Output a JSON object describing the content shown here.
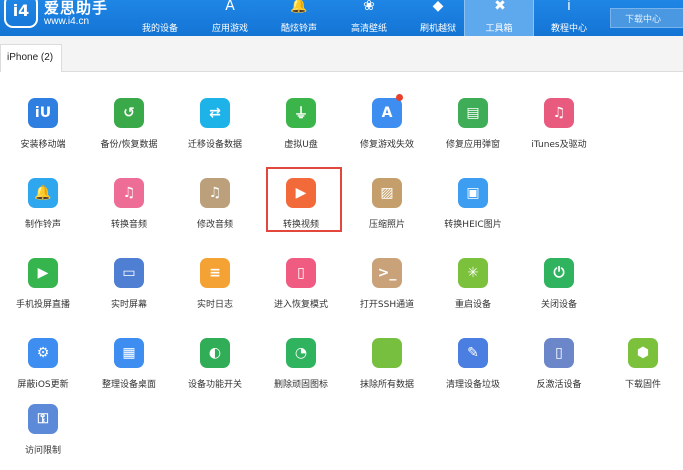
{
  "app": {
    "name": "爱思助手",
    "url": "www.i4.cn",
    "logo_text": "i4"
  },
  "nav": [
    {
      "label": "我的设备",
      "icon": "apple-icon",
      "glyph": ""
    },
    {
      "label": "应用游戏",
      "icon": "app-store-icon",
      "glyph": "A"
    },
    {
      "label": "酷炫铃声",
      "icon": "bell-icon",
      "glyph": "🔔"
    },
    {
      "label": "高清壁纸",
      "icon": "flower-icon",
      "glyph": "❀"
    },
    {
      "label": "刷机越狱",
      "icon": "dropbox-icon",
      "glyph": "◆"
    },
    {
      "label": "工具箱",
      "icon": "toolbox-icon",
      "glyph": "✖"
    },
    {
      "label": "教程中心",
      "icon": "info-icon",
      "glyph": "i"
    }
  ],
  "download_center": "下载中心",
  "device_tab": "iPhone (2)",
  "tools": [
    {
      "label": "安装移动端",
      "icon": "i4-mobile-icon",
      "color": "#2f7fe0",
      "glyph": "iU",
      "has_dot": false
    },
    {
      "label": "备份/恢复数据",
      "icon": "backup-clock-icon",
      "color": "#3aa94a",
      "glyph": "↺",
      "has_dot": false
    },
    {
      "label": "迁移设备数据",
      "icon": "transfer-devices-icon",
      "color": "#1db3e8",
      "glyph": "⇄",
      "has_dot": false
    },
    {
      "label": "虚拟U盘",
      "icon": "usb-drive-icon",
      "color": "#3bb54a",
      "glyph": "⏚",
      "has_dot": false
    },
    {
      "label": "修复游戏失效",
      "icon": "app-store-repair-icon",
      "color": "#3d8ef0",
      "glyph": "A",
      "has_dot": true
    },
    {
      "label": "修复应用弹窗",
      "icon": "apple-id-card-icon",
      "color": "#3fad57",
      "glyph": "▤",
      "has_dot": false
    },
    {
      "label": "iTunes及驱动",
      "icon": "itunes-icon",
      "color": "#e95b7e",
      "glyph": "♫",
      "has_dot": false
    },
    {
      "label": "制作铃声",
      "icon": "bell-plus-icon",
      "color": "#2fa7ef",
      "glyph": "🔔",
      "has_dot": false
    },
    {
      "label": "转换音频",
      "icon": "audio-convert-icon",
      "color": "#ee6d96",
      "glyph": "♫",
      "has_dot": false
    },
    {
      "label": "修改音频",
      "icon": "audio-edit-icon",
      "color": "#bba07b",
      "glyph": "♫",
      "has_dot": false
    },
    {
      "label": "转换视频",
      "icon": "video-convert-icon",
      "color": "#f36a3a",
      "glyph": "▶",
      "has_dot": false
    },
    {
      "label": "压缩照片",
      "icon": "photo-compress-icon",
      "color": "#c59f6b",
      "glyph": "▨",
      "has_dot": false
    },
    {
      "label": "转换HEIC图片",
      "icon": "heic-convert-icon",
      "color": "#3d9df0",
      "glyph": "▣",
      "has_dot": false
    },
    {
      "label": "手机投屏直播",
      "icon": "screen-cast-icon",
      "color": "#36b44d",
      "glyph": "▶",
      "has_dot": false
    },
    {
      "label": "实时屏幕",
      "icon": "monitor-icon",
      "color": "#4f7fd3",
      "glyph": "▭",
      "has_dot": false
    },
    {
      "label": "实时日志",
      "icon": "log-document-icon",
      "color": "#f4a233",
      "glyph": "≡",
      "has_dot": false
    },
    {
      "label": "进入恢复模式",
      "icon": "recovery-mode-icon",
      "color": "#ef5b81",
      "glyph": "▯",
      "has_dot": false
    },
    {
      "label": "打开SSH通道",
      "icon": "ssh-terminal-icon",
      "color": "#c9a27a",
      "glyph": ">_",
      "has_dot": false
    },
    {
      "label": "重启设备",
      "icon": "restart-icon",
      "color": "#7cc13c",
      "glyph": "✳",
      "has_dot": false
    },
    {
      "label": "关闭设备",
      "icon": "power-icon",
      "color": "#2fb35e",
      "glyph": "⏻",
      "has_dot": false
    },
    {
      "label": "屏蔽iOS更新",
      "icon": "block-update-gear-icon",
      "color": "#3d8ef0",
      "glyph": "⚙",
      "has_dot": false
    },
    {
      "label": "整理设备桌面",
      "icon": "desktop-grid-icon",
      "color": "#3d8ef0",
      "glyph": "▦",
      "has_dot": false
    },
    {
      "label": "设备功能开关",
      "icon": "function-toggle-icon",
      "color": "#32ad57",
      "glyph": "◐",
      "has_dot": false
    },
    {
      "label": "删除顽固图标",
      "icon": "delete-icon-pie-icon",
      "color": "#2fb35e",
      "glyph": "◔",
      "has_dot": false
    },
    {
      "label": "抹除所有数据",
      "icon": "erase-apple-icon",
      "color": "#76bf3f",
      "glyph": "",
      "has_dot": false
    },
    {
      "label": "清理设备垃圾",
      "icon": "cleanup-broom-icon",
      "color": "#4a7ee0",
      "glyph": "✎",
      "has_dot": false
    },
    {
      "label": "反激活设备",
      "icon": "deactivate-device-icon",
      "color": "#6b86c9",
      "glyph": "▯",
      "has_dot": false
    },
    {
      "label": "下载固件",
      "icon": "firmware-box-icon",
      "color": "#7bc13c",
      "glyph": "⬢",
      "has_dot": false
    },
    {
      "label": "访问限制",
      "icon": "access-restriction-icon",
      "color": "#5c89d8",
      "glyph": "⚿",
      "has_dot": false
    }
  ],
  "selected_tool": "转换视频"
}
